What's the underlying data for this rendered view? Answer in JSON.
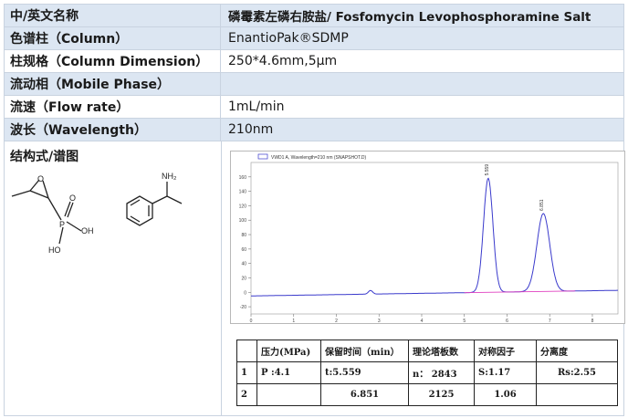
{
  "info_rows": [
    {
      "label": "中/英文名称",
      "value": "磷霉素左磷右胺盐/ Fosfomycin Levophosphoramine Salt"
    },
    {
      "label": "色谱柱（Column）",
      "value": "EnantioPak®SDMP"
    },
    {
      "label": "柱规格（Column Dimension）",
      "value": "250*4.6mm,5μm"
    },
    {
      "label": "流动相（Mobile Phase）",
      "value": ""
    },
    {
      "label": "流速（Flow rate）",
      "value": "1mL/min"
    },
    {
      "label": "波长（Wavelength）",
      "value": "210nm"
    }
  ],
  "structure_title": "结构式/谱图",
  "molecule_a": {
    "o_label": "O",
    "p_label": "P",
    "o2_label": "O",
    "oh1": "OH",
    "oh2": "HO"
  },
  "molecule_b": {
    "nh2_label": "NH₂"
  },
  "chart_data": {
    "type": "line",
    "title": "",
    "legend": "VWD1 A, Wavelength=210 nm (SNAPSHOT.D)",
    "xlim": [
      0,
      8.6
    ],
    "ylim": [
      -30,
      180
    ],
    "x_ticks": [
      0,
      1,
      2,
      3,
      4,
      5,
      6,
      7,
      8
    ],
    "y_ticks": [
      -20,
      0,
      20,
      40,
      60,
      80,
      100,
      120,
      140,
      160
    ],
    "peaks": [
      {
        "rt": 5.559,
        "height": 158,
        "label": "5.559"
      },
      {
        "rt": 6.851,
        "height": 108,
        "label": "6.851"
      }
    ],
    "small_peaks": [
      {
        "rt": 2.8,
        "height": 5
      }
    ]
  },
  "results_table": {
    "headers": [
      "",
      "压力(MPa)",
      "保留时间（min）",
      "理论塔板数",
      "对称因子",
      "分离度"
    ],
    "rows": [
      [
        "1",
        "P :4.1",
        "t:5.559",
        "n： 2843",
        "S:1.17",
        "Rs:2.55"
      ],
      [
        "2",
        "",
        "6.851",
        "2125",
        "1.06",
        ""
      ]
    ]
  }
}
